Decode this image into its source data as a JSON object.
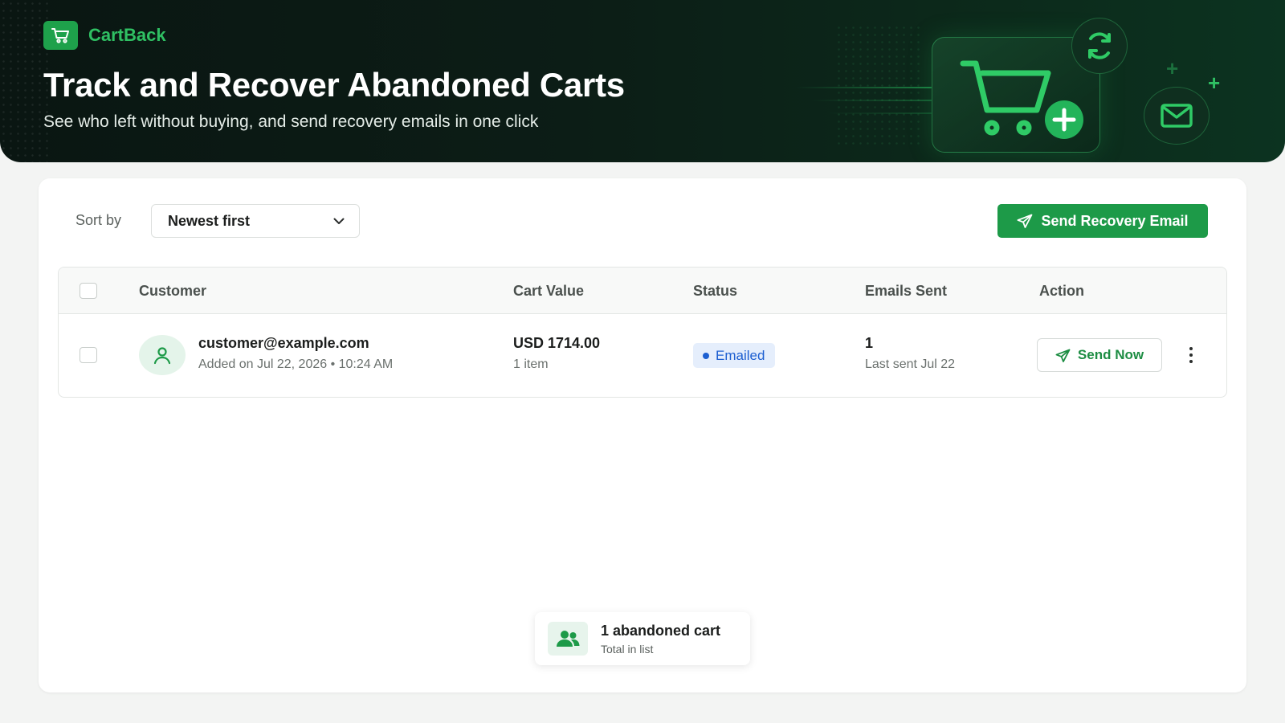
{
  "app": {
    "name": "CartBack",
    "title": "Track and Recover Abandoned Carts",
    "subtitle": "See who left without buying, and send recovery emails in one click"
  },
  "toolbar": {
    "sort_label": "Sort by",
    "sort_value": "Newest first",
    "primary_action": "Send Recovery Email"
  },
  "table": {
    "columns": [
      "Customer",
      "Cart Value",
      "Status",
      "Emails Sent",
      "Action"
    ],
    "rows": [
      {
        "email": "customer@example.com",
        "added": "Added on Jul 22, 2026 • 10:24 AM",
        "value": "USD 1714.00",
        "items": "1 item",
        "status": "Emailed",
        "emails_sent": "1",
        "last_sent": "Last sent Jul 22",
        "action": "Send Now"
      }
    ]
  },
  "summary": {
    "count_label": "1 abandoned cart",
    "sub_label": "Total in list"
  },
  "colors": {
    "brand_green": "#1d9a48",
    "hero_dark": "#0b1a14",
    "status_blue": "#1d5fd1"
  },
  "icons": [
    "cart-icon",
    "sync-icon",
    "mail-icon",
    "send-icon",
    "chevron-down-icon",
    "user-icon",
    "users-icon",
    "more-vertical-icon"
  ]
}
